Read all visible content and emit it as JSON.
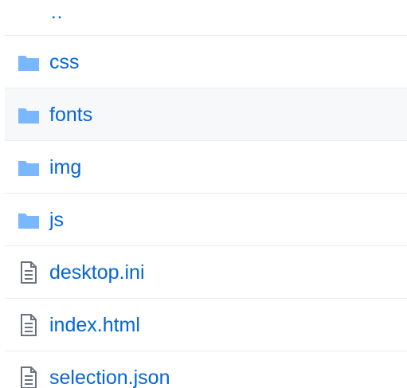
{
  "file_list": {
    "parent": {
      "label": "..",
      "icon": "parent-directory"
    },
    "items": [
      {
        "name": "css",
        "type": "folder",
        "icon": "folder-icon"
      },
      {
        "name": "fonts",
        "type": "folder",
        "icon": "folder-icon"
      },
      {
        "name": "img",
        "type": "folder",
        "icon": "folder-icon"
      },
      {
        "name": "js",
        "type": "folder",
        "icon": "folder-icon"
      },
      {
        "name": "desktop.ini",
        "type": "file",
        "icon": "file-icon"
      },
      {
        "name": "index.html",
        "type": "file",
        "icon": "file-icon"
      },
      {
        "name": "selection.json",
        "type": "file",
        "icon": "file-icon"
      }
    ]
  },
  "colors": {
    "link": "#0366d6",
    "folder_icon": "#79b8ff",
    "file_icon": "#6a737d",
    "row_border": "#e9ecef",
    "hover_row": "#f6f8fa"
  }
}
